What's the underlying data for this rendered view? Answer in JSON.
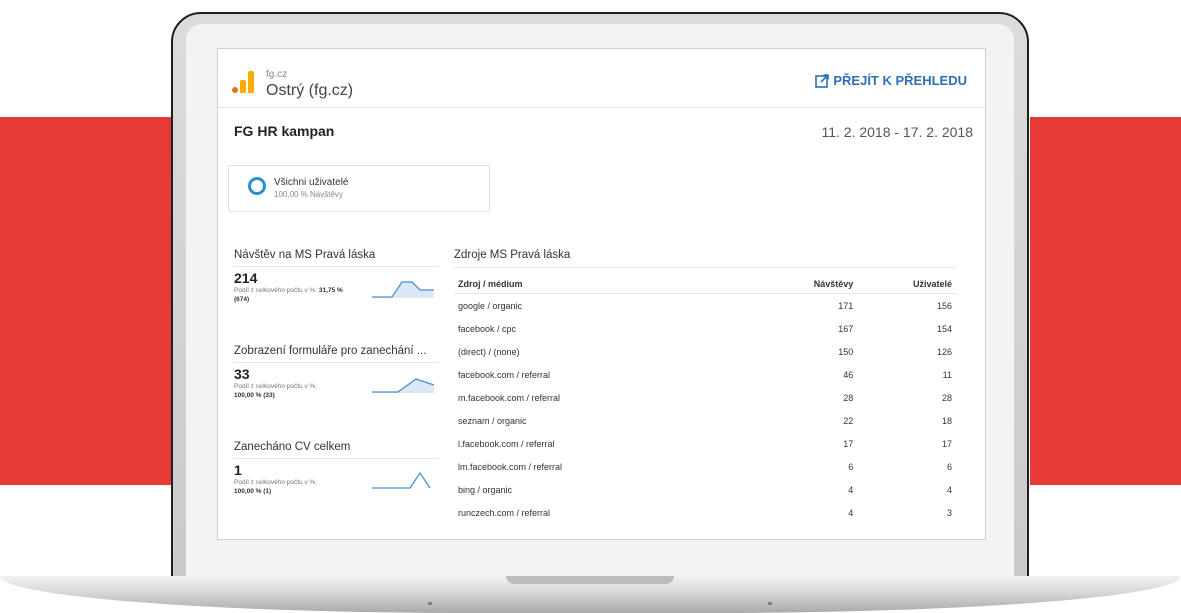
{
  "header": {
    "property_domain": "fg.cz",
    "property_name": "Ostrý (fg.cz)",
    "goto_label": "PŘEJÍT K PŘEHLEDU"
  },
  "report": {
    "title": "FG HR kampan",
    "date_range": "11. 2. 2018 - 17. 2. 2018"
  },
  "segment": {
    "name": "Všichni uživatelé",
    "subtitle": "100,00 % Návštěvy"
  },
  "metrics": [
    {
      "title": "Návštěv na MS Pravá láska",
      "value": "214",
      "pct_label": "Podíl z celkového počtu v %:",
      "pct_value": "31,75 %",
      "total": "(674)"
    },
    {
      "title": "Zobrazení formuláře pro zanechání ...",
      "value": "33",
      "pct_label": "Podíl z celkového počtu v %:",
      "pct_value": "100,00 % (33)",
      "total": ""
    },
    {
      "title": "Zanecháno CV celkem",
      "value": "1",
      "pct_label": "Podíl z celkového počtu v %:",
      "pct_value": "100,00 % (1)",
      "total": ""
    }
  ],
  "sources_table": {
    "title": "Zdroje MS Pravá láska",
    "columns": [
      "Zdroj / médium",
      "Návštěvy",
      "Uživatelé"
    ],
    "rows": [
      [
        "google / organic",
        "171",
        "156"
      ],
      [
        "facebook / cpc",
        "167",
        "154"
      ],
      [
        "(direct) / (none)",
        "150",
        "126"
      ],
      [
        "facebook.com / referral",
        "46",
        "11"
      ],
      [
        "m.facebook.com / referral",
        "28",
        "28"
      ],
      [
        "seznam / organic",
        "22",
        "18"
      ],
      [
        "l.facebook.com / referral",
        "17",
        "17"
      ],
      [
        "lm.facebook.com / referral",
        "6",
        "6"
      ],
      [
        "bing / organic",
        "4",
        "4"
      ],
      [
        "runczech.com / referral",
        "4",
        "3"
      ]
    ]
  },
  "colors": {
    "background_accent": "#e63a36",
    "link": "#2f6fb8",
    "segment_ring": "#2a8fd1",
    "logo_orange": "#f9ab00",
    "logo_dark_orange": "#e37400",
    "sparkline": "#4a90d9"
  },
  "icons": {
    "logo": "analytics-logo-icon",
    "goto": "external-link-icon",
    "segment": "segment-ring-icon"
  }
}
